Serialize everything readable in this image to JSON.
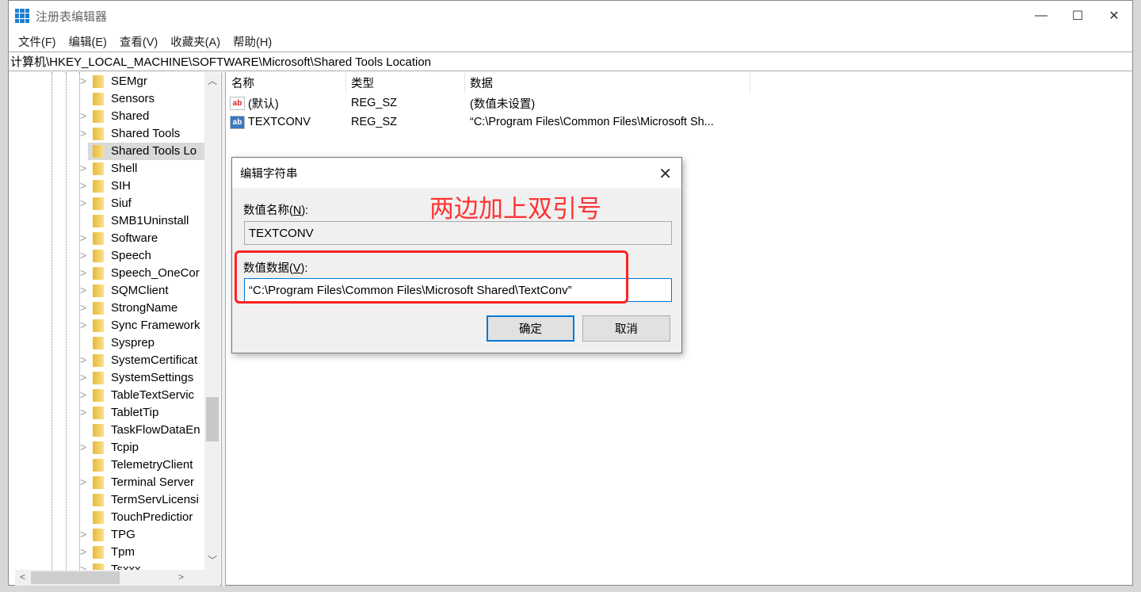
{
  "window": {
    "title": "注册表编辑器",
    "minimize": "—",
    "maximize": "☐",
    "close": "✕"
  },
  "menu": [
    "文件(F)",
    "编辑(E)",
    "查看(V)",
    "收藏夹(A)",
    "帮助(H)"
  ],
  "address": "计算机\\HKEY_LOCAL_MACHINE\\SOFTWARE\\Microsoft\\Shared Tools Location",
  "tree": [
    {
      "label": "SEMgr",
      "expandable": true
    },
    {
      "label": "Sensors",
      "expandable": false
    },
    {
      "label": "Shared",
      "expandable": true
    },
    {
      "label": "Shared Tools",
      "expandable": true
    },
    {
      "label": "Shared Tools Lo",
      "expandable": false,
      "selected": true
    },
    {
      "label": "Shell",
      "expandable": true
    },
    {
      "label": "SIH",
      "expandable": true
    },
    {
      "label": "Siuf",
      "expandable": true
    },
    {
      "label": "SMB1Uninstall",
      "expandable": false
    },
    {
      "label": "Software",
      "expandable": true
    },
    {
      "label": "Speech",
      "expandable": true
    },
    {
      "label": "Speech_OneCor",
      "expandable": true
    },
    {
      "label": "SQMClient",
      "expandable": true
    },
    {
      "label": "StrongName",
      "expandable": true
    },
    {
      "label": "Sync Framework",
      "expandable": true
    },
    {
      "label": "Sysprep",
      "expandable": false
    },
    {
      "label": "SystemCertificat",
      "expandable": true
    },
    {
      "label": "SystemSettings",
      "expandable": true
    },
    {
      "label": "TableTextServic",
      "expandable": true
    },
    {
      "label": "TabletTip",
      "expandable": true
    },
    {
      "label": "TaskFlowDataEn",
      "expandable": false
    },
    {
      "label": "Tcpip",
      "expandable": true
    },
    {
      "label": "TelemetryClient",
      "expandable": false
    },
    {
      "label": "Terminal Server",
      "expandable": true
    },
    {
      "label": "TermServLicensi",
      "expandable": false
    },
    {
      "label": "TouchPredictior",
      "expandable": false
    },
    {
      "label": "TPG",
      "expandable": true
    },
    {
      "label": "Tpm",
      "expandable": true
    },
    {
      "label": "Tsxxx",
      "expandable": true
    }
  ],
  "columns": {
    "name": "名称",
    "type": "类型",
    "data": "数据"
  },
  "values": [
    {
      "name": "(默认)",
      "type": "REG_SZ",
      "data": "(数值未设置)",
      "icon": "red"
    },
    {
      "name": "TEXTCONV",
      "type": "REG_SZ",
      "data": "“C:\\Program Files\\Common Files\\Microsoft Sh...",
      "icon": "blue"
    }
  ],
  "dialog": {
    "title": "编辑字符串",
    "name_label_pre": "数值名称(",
    "name_label_key": "N",
    "name_label_post": "):",
    "name_value": "TEXTCONV",
    "data_label_pre": "数值数据(",
    "data_label_key": "V",
    "data_label_post": "):",
    "data_value": "“C:\\Program Files\\Common Files\\Microsoft Shared\\TextConv”",
    "ok": "确定",
    "cancel": "取消"
  },
  "annotation": {
    "text": "两边加上双引号",
    "color": "#ff2222"
  }
}
